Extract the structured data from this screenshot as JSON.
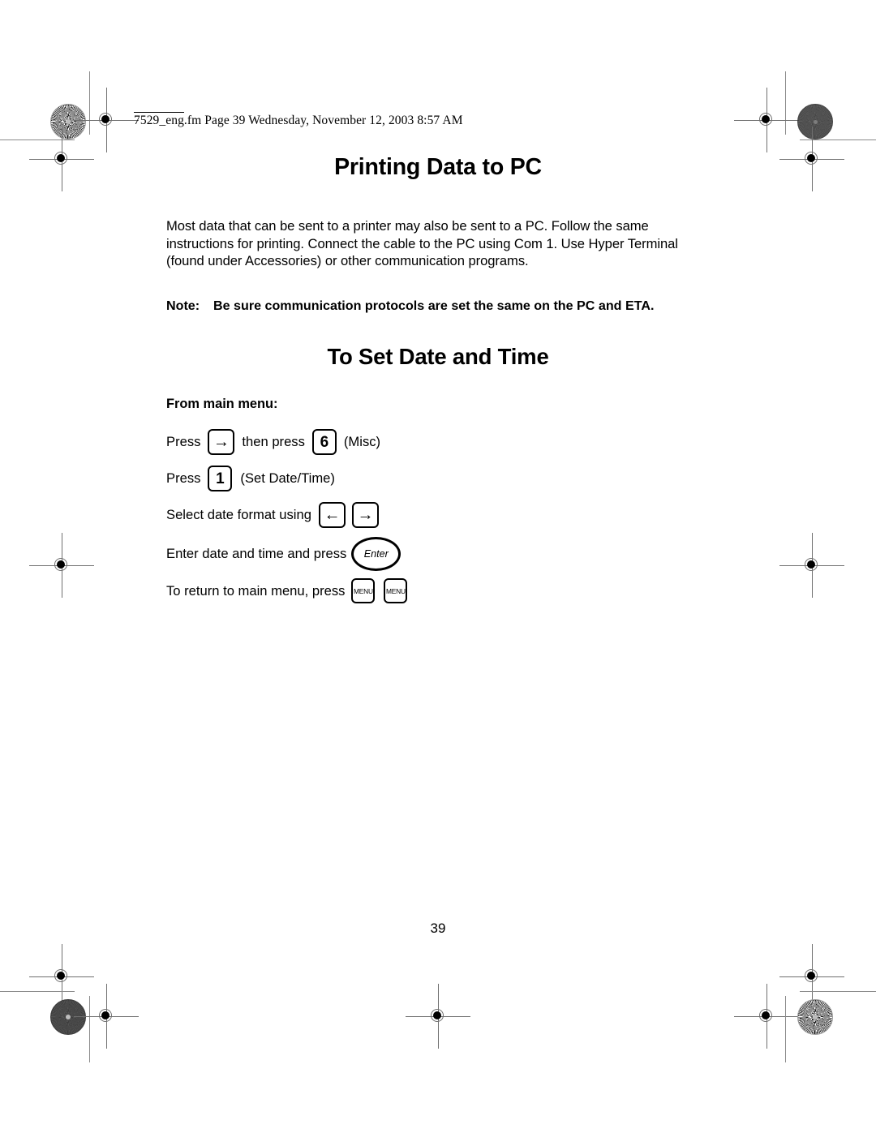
{
  "running_head": "7529_eng.fm  Page 39  Wednesday, November 12, 2003  8:57 AM",
  "document": {
    "title": "Printing Data to PC",
    "intro": "Most data that can be sent to a printer may also be sent to a PC. Follow the same instructions for printing. Connect the cable to the PC using Com 1. Use Hyper Terminal (found under Accessories) or other communication programs.",
    "note": {
      "label": "Note:",
      "text": "Be sure communication protocols are set the same on the PC and ETA."
    },
    "section": {
      "title": "To Set Date and Time",
      "lead_in": "From main menu:",
      "steps": [
        {
          "pre": "Press",
          "key1": "→",
          "mid": "then press",
          "key2": "6",
          "post": "(Misc)"
        },
        {
          "pre": "Press",
          "key1": "1",
          "post": "(Set Date/Time)"
        },
        {
          "pre": "Select date format using",
          "key1": "←",
          "key2": "→"
        },
        {
          "pre": "Enter date and time and press",
          "key1": "Enter"
        },
        {
          "pre": "To return to main menu, press",
          "key1": "MENU",
          "key2": "MENU"
        }
      ]
    }
  },
  "folio": "39",
  "colors": {
    "ink": "#000000",
    "registration": "#6f6f6f",
    "trim_rule": "#8a8a8a",
    "paper": "#ffffff"
  }
}
